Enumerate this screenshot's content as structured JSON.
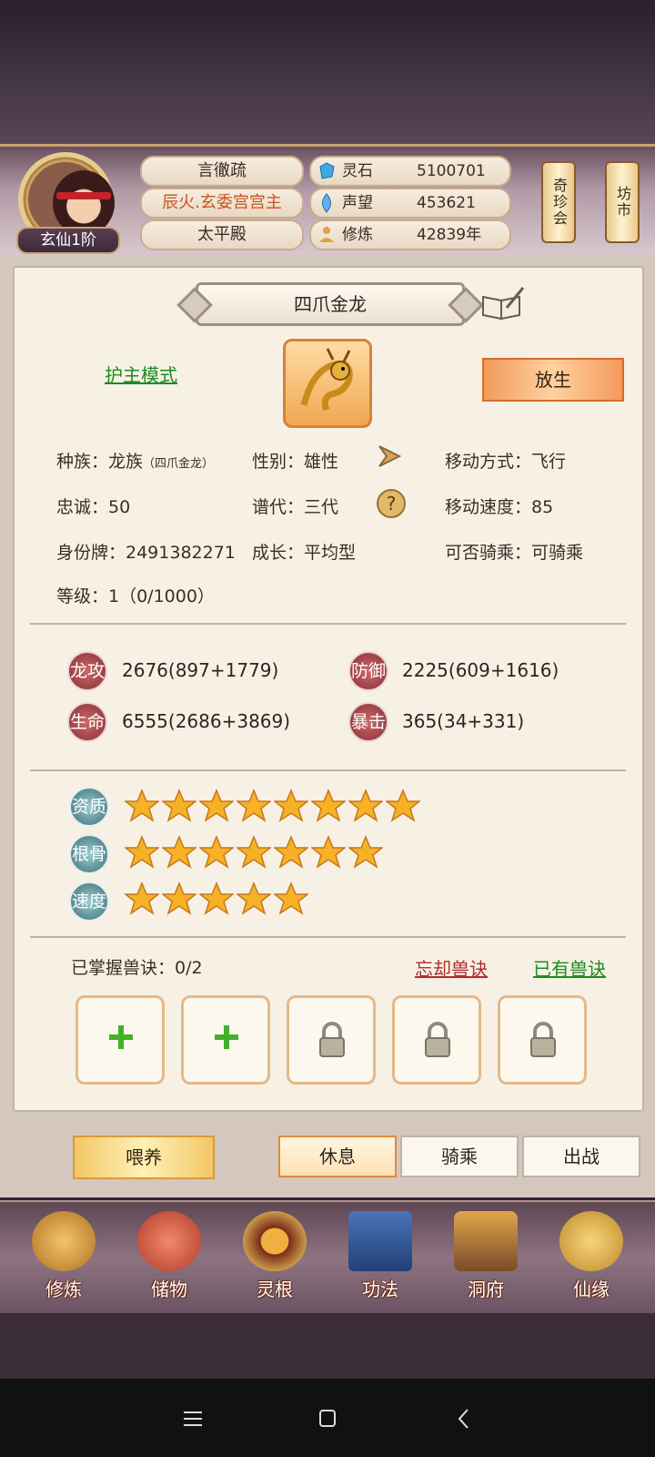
{
  "header": {
    "rank": "玄仙1阶",
    "name": "言徹疏",
    "title": "辰火.玄委宫宫主",
    "hall": "太平殿",
    "resources": [
      {
        "icon": "spirit-stone-icon",
        "label": "灵石",
        "value": "5100701"
      },
      {
        "icon": "reputation-icon",
        "label": "声望",
        "value": "453621"
      },
      {
        "icon": "cultivation-icon",
        "label": "修炼",
        "value": "42839年"
      }
    ],
    "side_buttons": [
      "奇珍会",
      "坊市"
    ]
  },
  "pet": {
    "name": "四爪金龙",
    "guard_mode": "护主模式",
    "release": "放生",
    "race_label": "种族：",
    "race_value": "龙族",
    "race_sub": "（四爪金龙）",
    "gender": "性别：雄性",
    "move_type": "移动方式：飞行",
    "loyalty": "忠诚：50",
    "generation": "谱代：三代",
    "move_speed": "移动速度：85",
    "id_tag": "身份牌：2491382271",
    "growth": "成长：平均型",
    "rideable": "可否骑乘：可骑乘",
    "level": "等级：1（0/1000）"
  },
  "stats": [
    {
      "icon": "龙攻",
      "value": "2676(897+1779)"
    },
    {
      "icon": "防御",
      "value": "2225(609+1616)"
    },
    {
      "icon": "生命",
      "value": "6555(2686+3869)"
    },
    {
      "icon": "暴击",
      "value": "365(34+331)"
    }
  ],
  "aptitudes": [
    {
      "label": "资质",
      "stars": 8
    },
    {
      "label": "根骨",
      "stars": 7
    },
    {
      "label": "速度",
      "stars": 5
    }
  ],
  "skills": {
    "mastered": "已掌握兽诀：0/2",
    "forget": "忘却兽诀",
    "owned": "已有兽诀",
    "slots": [
      "add",
      "add",
      "locked",
      "locked",
      "locked"
    ]
  },
  "actions": {
    "feed": "喂养",
    "rest": "休息",
    "ride": "骑乘",
    "battle": "出战"
  },
  "nav": [
    "修炼",
    "储物",
    "灵根",
    "功法",
    "洞府",
    "仙缘"
  ],
  "colors": {
    "accent": "#f39a5b",
    "link_green": "#1f8a22",
    "link_red": "#b32b2b"
  }
}
